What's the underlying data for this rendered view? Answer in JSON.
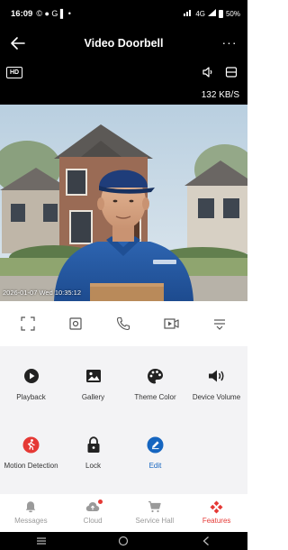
{
  "status_bar": {
    "time": "16:09",
    "left_icons": "© ● G ▌ •",
    "network": "4G",
    "battery": "50%"
  },
  "header": {
    "title": "Video Doorbell",
    "back_icon": "arrow-left-icon",
    "more_icon": "more-dots-icon",
    "more_text": "···"
  },
  "video": {
    "quality_badge": "HD",
    "data_rate": "132 KB/S",
    "timestamp": "2026-01-07 Wed 10:35:12"
  },
  "controls": [
    {
      "name": "fullscreen-icon"
    },
    {
      "name": "screenshot-icon"
    },
    {
      "name": "call-icon"
    },
    {
      "name": "record-icon"
    },
    {
      "name": "collapse-menu-icon"
    }
  ],
  "features": [
    {
      "label": "Playback",
      "icon": "play-circle-icon"
    },
    {
      "label": "Gallery",
      "icon": "image-icon"
    },
    {
      "label": "Theme Color",
      "icon": "palette-icon"
    },
    {
      "label": "Device Volume",
      "icon": "volume-icon"
    },
    {
      "label": "Motion Detection",
      "icon": "motion-detection-icon"
    },
    {
      "label": "Lock",
      "icon": "lock-icon"
    },
    {
      "label": "Edit",
      "icon": "edit-icon"
    }
  ],
  "bottom_nav": [
    {
      "label": "Messages",
      "icon": "bell-icon",
      "active": false
    },
    {
      "label": "Cloud",
      "icon": "cloud-icon",
      "active": false,
      "has_dot": true
    },
    {
      "label": "Service Hall",
      "icon": "cart-icon",
      "active": false
    },
    {
      "label": "Features",
      "icon": "features-icon",
      "active": true
    }
  ],
  "colors": {
    "accent_red": "#e53935",
    "edit_blue": "#1565c0",
    "features_bg": "#f3f3f5"
  }
}
